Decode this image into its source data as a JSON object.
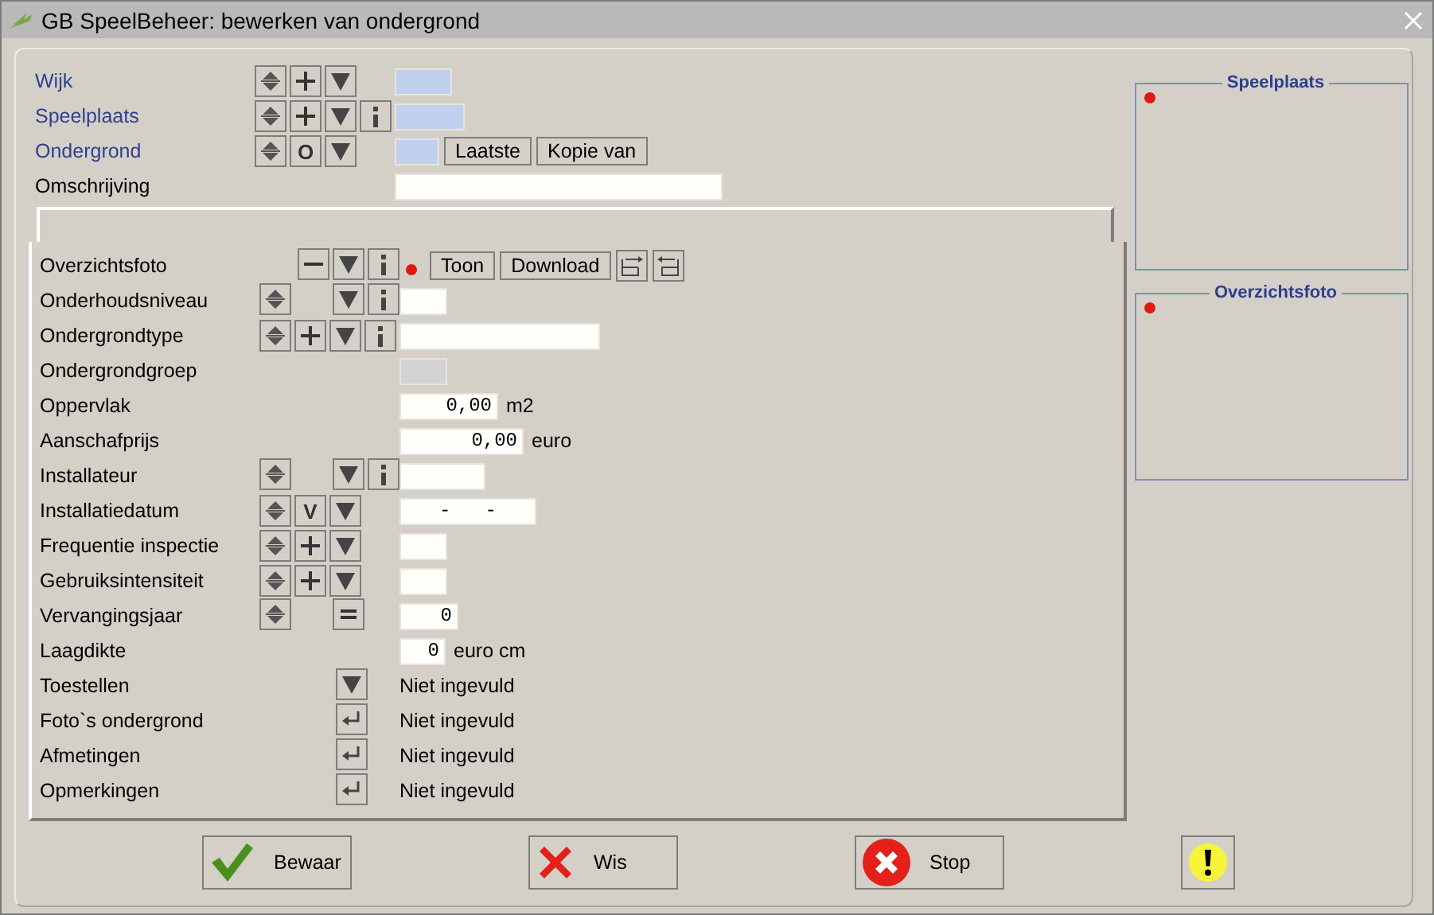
{
  "window": {
    "title": "GB SpeelBeheer: bewerken van ondergrond"
  },
  "header_rows": [
    {
      "label": "Wijk",
      "linked": true,
      "buttons": [
        {
          "kind": "updown"
        },
        {
          "kind": "plus"
        },
        {
          "kind": "dropdown"
        }
      ],
      "field": {
        "kind": "key"
      }
    },
    {
      "label": "Speelplaats",
      "linked": true,
      "buttons": [
        {
          "kind": "updown"
        },
        {
          "kind": "plus"
        },
        {
          "kind": "dropdown"
        },
        {
          "kind": "info"
        }
      ],
      "field": {
        "kind": "key"
      }
    },
    {
      "label": "Ondergrond",
      "linked": true,
      "buttons": [
        {
          "kind": "updown"
        },
        {
          "kind": "letter",
          "label": "O"
        },
        {
          "kind": "dropdown"
        }
      ],
      "field": {
        "kind": "key"
      },
      "actions": [
        {
          "label": "Laatste"
        },
        {
          "label": "Kopie van"
        }
      ]
    },
    {
      "label": "Omschrijving",
      "linked": false,
      "buttons": [],
      "field": {
        "kind": "text"
      }
    }
  ],
  "detail_rows": [
    {
      "label": "Overzichtsfoto",
      "buttons": [
        {
          "kind": "blank"
        },
        {
          "kind": "minus"
        },
        {
          "kind": "dropdown"
        },
        {
          "kind": "info"
        }
      ],
      "field": {
        "kind": "photo",
        "photo_missing": true,
        "actions": [
          {
            "label": "Toon"
          },
          {
            "label": "Download"
          }
        ],
        "tools": [
          {
            "kind": "export"
          },
          {
            "kind": "import"
          }
        ]
      }
    },
    {
      "label": "Onderhoudsniveau",
      "buttons": [
        {
          "kind": "updown"
        },
        {
          "kind": "blank"
        },
        {
          "kind": "dropdown"
        },
        {
          "kind": "info"
        }
      ],
      "field": {
        "kind": "text"
      }
    },
    {
      "label": "Ondergrondtype",
      "buttons": [
        {
          "kind": "updown"
        },
        {
          "kind": "plus"
        },
        {
          "kind": "dropdown"
        },
        {
          "kind": "info"
        }
      ],
      "field": {
        "kind": "text"
      }
    },
    {
      "label": "Ondergrondgroep",
      "buttons": [],
      "field": {
        "kind": "readonly"
      }
    },
    {
      "label": "Oppervlak",
      "buttons": [],
      "field": {
        "kind": "number",
        "value": "0,00",
        "unit": "m2"
      }
    },
    {
      "label": "Aanschafprijs",
      "buttons": [],
      "field": {
        "kind": "number",
        "value": "0,00",
        "unit": "euro"
      }
    },
    {
      "label": "Installateur",
      "buttons": [
        {
          "kind": "updown"
        },
        {
          "kind": "blank"
        },
        {
          "kind": "dropdown"
        },
        {
          "kind": "info"
        }
      ],
      "field": {
        "kind": "text"
      }
    },
    {
      "label": "Installatiedatum",
      "buttons": [
        {
          "kind": "updown"
        },
        {
          "kind": "letter",
          "label": "V"
        },
        {
          "kind": "dropdown"
        }
      ],
      "field": {
        "kind": "date",
        "value": "-   -"
      }
    },
    {
      "label": "Frequentie inspectie",
      "buttons": [
        {
          "kind": "updown"
        },
        {
          "kind": "plus"
        },
        {
          "kind": "dropdown"
        }
      ],
      "field": {
        "kind": "text"
      }
    },
    {
      "label": "Gebruiksintensiteit",
      "buttons": [
        {
          "kind": "updown"
        },
        {
          "kind": "plus"
        },
        {
          "kind": "dropdown"
        }
      ],
      "field": {
        "kind": "text"
      }
    },
    {
      "label": "Vervangingsjaar",
      "buttons": [
        {
          "kind": "updown"
        },
        {
          "kind": "blank"
        },
        {
          "kind": "equals"
        }
      ],
      "field": {
        "kind": "number",
        "value": "0"
      }
    },
    {
      "label": "Laagdikte",
      "buttons": [],
      "field": {
        "kind": "number",
        "value": "0",
        "unit": "euro cm"
      }
    },
    {
      "label": "Toestellen",
      "buttons": [
        {
          "kind": "blank"
        },
        {
          "kind": "blank"
        },
        {
          "kind": "dropdown"
        }
      ],
      "field": {
        "kind": "status",
        "value": "Niet ingevuld"
      }
    },
    {
      "label": "Foto`s ondergrond",
      "buttons": [
        {
          "kind": "blank"
        },
        {
          "kind": "blank"
        },
        {
          "kind": "enter"
        }
      ],
      "field": {
        "kind": "status",
        "value": "Niet ingevuld"
      }
    },
    {
      "label": "Afmetingen",
      "buttons": [
        {
          "kind": "blank"
        },
        {
          "kind": "blank"
        },
        {
          "kind": "enter"
        }
      ],
      "field": {
        "kind": "status",
        "value": "Niet ingevuld"
      }
    },
    {
      "label": "Opmerkingen",
      "buttons": [
        {
          "kind": "blank"
        },
        {
          "kind": "blank"
        },
        {
          "kind": "enter"
        }
      ],
      "field": {
        "kind": "status",
        "value": "Niet ingevuld"
      }
    }
  ],
  "side_panels": [
    {
      "title": "Speelplaats",
      "photo_missing": true
    },
    {
      "title": "Overzichtsfoto",
      "photo_missing": true
    }
  ],
  "footer_buttons": [
    {
      "kind": "save",
      "label": "Bewaar"
    },
    {
      "kind": "clear",
      "label": "Wis"
    },
    {
      "kind": "stop",
      "label": "Stop"
    },
    {
      "kind": "warning"
    }
  ]
}
